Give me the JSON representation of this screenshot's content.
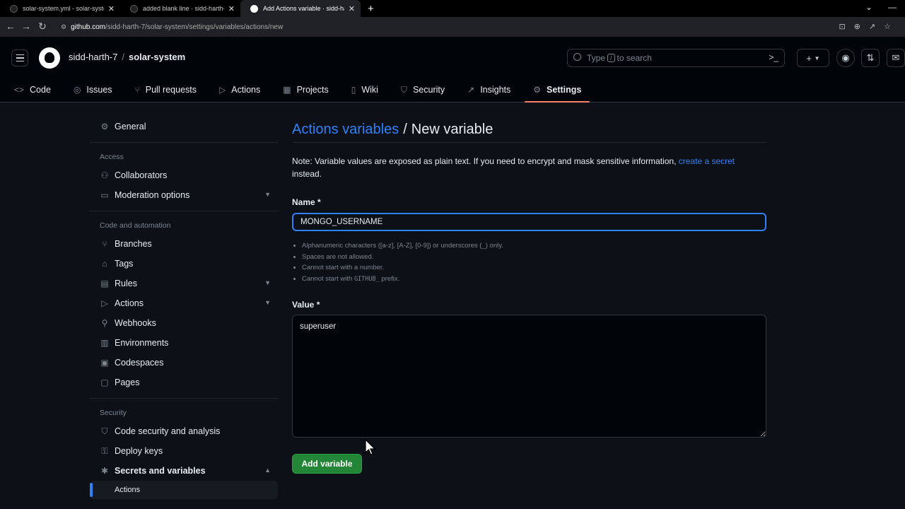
{
  "browser": {
    "tabs": [
      {
        "title": "solar-system.yml - solar-system",
        "active": false
      },
      {
        "title": "added blank line · sidd-harth-7/",
        "active": false
      },
      {
        "title": "Add Actions variable · sidd-harth",
        "active": true
      }
    ],
    "new_tab": "+",
    "url_host": "github.com",
    "url_path": "/sidd-harth-7/solar-system/settings/variables/actions/new"
  },
  "header": {
    "owner": "sidd-harth-7",
    "separator": "/",
    "repo": "solar-system",
    "search_prefix": "Type",
    "search_key": "/",
    "search_suffix": "to search",
    "plus": "+"
  },
  "repo_nav": [
    {
      "label": "Code",
      "icon": "code-icon"
    },
    {
      "label": "Issues",
      "icon": "issue-icon"
    },
    {
      "label": "Pull requests",
      "icon": "pull-request-icon"
    },
    {
      "label": "Actions",
      "icon": "play-icon"
    },
    {
      "label": "Projects",
      "icon": "table-icon"
    },
    {
      "label": "Wiki",
      "icon": "book-icon"
    },
    {
      "label": "Security",
      "icon": "shield-icon"
    },
    {
      "label": "Insights",
      "icon": "graph-icon"
    },
    {
      "label": "Settings",
      "icon": "gear-icon",
      "selected": true
    }
  ],
  "sidebar": {
    "general": "General",
    "access_heading": "Access",
    "collaborators": "Collaborators",
    "moderation": "Moderation options",
    "code_heading": "Code and automation",
    "branches": "Branches",
    "tags": "Tags",
    "rules": "Rules",
    "actions": "Actions",
    "webhooks": "Webhooks",
    "environments": "Environments",
    "codespaces": "Codespaces",
    "pages": "Pages",
    "security_heading": "Security",
    "code_security": "Code security and analysis",
    "deploy_keys": "Deploy keys",
    "secrets": "Secrets and variables",
    "secrets_actions": "Actions"
  },
  "main": {
    "breadcrumb_link": "Actions variables",
    "breadcrumb_sep": "/",
    "title": "New variable",
    "note_text": "Note: Variable values are exposed as plain text. If you need to encrypt and mask sensitive information,",
    "note_link": "create a secret",
    "note_end": "instead.",
    "name_label": "Name *",
    "name_value": "MONGO_USERNAME",
    "rules": [
      "Alphanumeric characters ([a-z], [A-Z], [0-9]) or underscores (_) only.",
      "Spaces are not allowed.",
      "Cannot start with a number."
    ],
    "rule_prefix_start": "Cannot start with",
    "rule_prefix_code": "GITHUB_",
    "rule_prefix_end": "prefix.",
    "value_label": "Value *",
    "value_value": "superuser",
    "add_button": "Add variable"
  },
  "colors": {
    "link": "#2f81f7",
    "primary_button": "#238636",
    "selected_tab_underline": "#f78166"
  }
}
